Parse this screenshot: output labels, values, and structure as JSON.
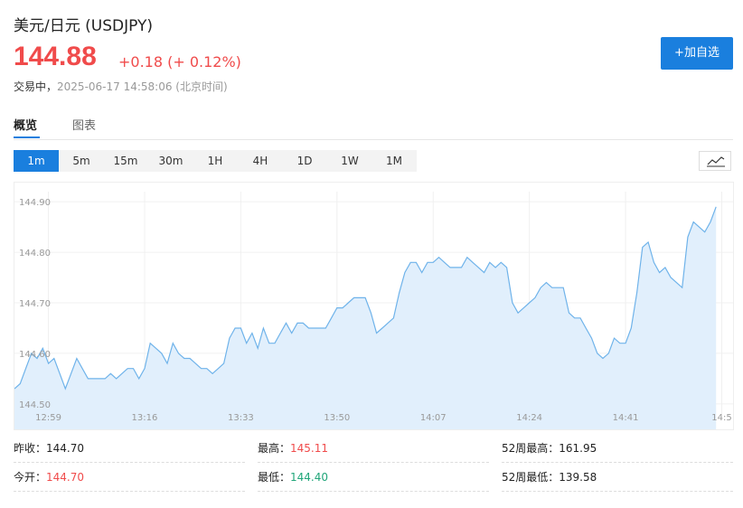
{
  "header": {
    "title": "美元/日元  (USDJPY)",
    "price": "144.88",
    "change": "+0.18 (+ 0.12%)",
    "status": "交易中",
    "datetime": "2025-06-17 14:58:06 (北京时间)",
    "add_button": "+加自选"
  },
  "tabs": [
    {
      "label": "概览",
      "active": true
    },
    {
      "label": "图表",
      "active": false
    }
  ],
  "periods": [
    "1m",
    "5m",
    "15m",
    "30m",
    "1H",
    "4H",
    "1D",
    "1W",
    "1M"
  ],
  "active_period": "1m",
  "chart_type_icon": "line-chart-icon",
  "colors": {
    "accent": "#1a7fde",
    "up": "#f04b4b",
    "down": "#21a67a",
    "line": "#6fb3ea",
    "fill": "#e1effc"
  },
  "chart_data": {
    "type": "area",
    "ylim": [
      144.48,
      144.92
    ],
    "y_ticks": [
      "144.90",
      "144.80",
      "144.70",
      "144.60",
      "144.50"
    ],
    "x_ticks": [
      "12:59",
      "13:16",
      "13:33",
      "13:50",
      "14:07",
      "14:24",
      "14:41",
      "14:5"
    ],
    "x_tick_minutes": [
      0,
      17,
      34,
      51,
      68,
      85,
      102,
      119
    ],
    "x_range_minutes": [
      -6,
      121
    ],
    "series": [
      {
        "values": [
          144.53,
          144.54,
          144.57,
          144.6,
          144.59,
          144.61,
          144.58,
          144.59,
          144.56,
          144.53,
          144.56,
          144.59,
          144.57,
          144.55,
          144.55,
          144.55,
          144.55,
          144.56,
          144.55,
          144.56,
          144.57,
          144.57,
          144.55,
          144.57,
          144.62,
          144.61,
          144.6,
          144.58,
          144.62,
          144.6,
          144.59,
          144.59,
          144.58,
          144.57,
          144.57,
          144.56,
          144.57,
          144.58,
          144.63,
          144.65,
          144.65,
          144.62,
          144.64,
          144.61,
          144.65,
          144.62,
          144.62,
          144.64,
          144.66,
          144.64,
          144.66,
          144.66,
          144.65,
          144.65,
          144.65,
          144.65,
          144.67,
          144.69,
          144.69,
          144.7,
          144.71,
          144.71,
          144.71,
          144.68,
          144.64,
          144.65,
          144.66,
          144.67,
          144.72,
          144.76,
          144.78,
          144.78,
          144.76,
          144.78,
          144.78,
          144.79,
          144.78,
          144.77,
          144.77,
          144.77,
          144.79,
          144.78,
          144.77,
          144.76,
          144.78,
          144.77,
          144.78,
          144.77,
          144.7,
          144.68,
          144.69,
          144.7,
          144.71,
          144.73,
          144.74,
          144.73,
          144.73,
          144.73,
          144.68,
          144.67,
          144.67,
          144.65,
          144.63,
          144.6,
          144.59,
          144.6,
          144.63,
          144.62,
          144.62,
          144.65,
          144.72,
          144.81,
          144.82,
          144.78,
          144.76,
          144.77,
          144.75,
          144.74,
          144.73,
          144.83,
          144.86,
          144.85,
          144.84,
          144.86,
          144.89
        ]
      }
    ]
  },
  "stats": [
    {
      "label": "昨收：",
      "value": "144.70",
      "color": ""
    },
    {
      "label": "最高：",
      "value": "145.11",
      "color": "red"
    },
    {
      "label": "52周最高：",
      "value": "161.95",
      "color": ""
    },
    {
      "label": "今开：",
      "value": "144.70",
      "color": "red"
    },
    {
      "label": "最低：",
      "value": "144.40",
      "color": "green"
    },
    {
      "label": "52周最低：",
      "value": "139.58",
      "color": ""
    }
  ]
}
